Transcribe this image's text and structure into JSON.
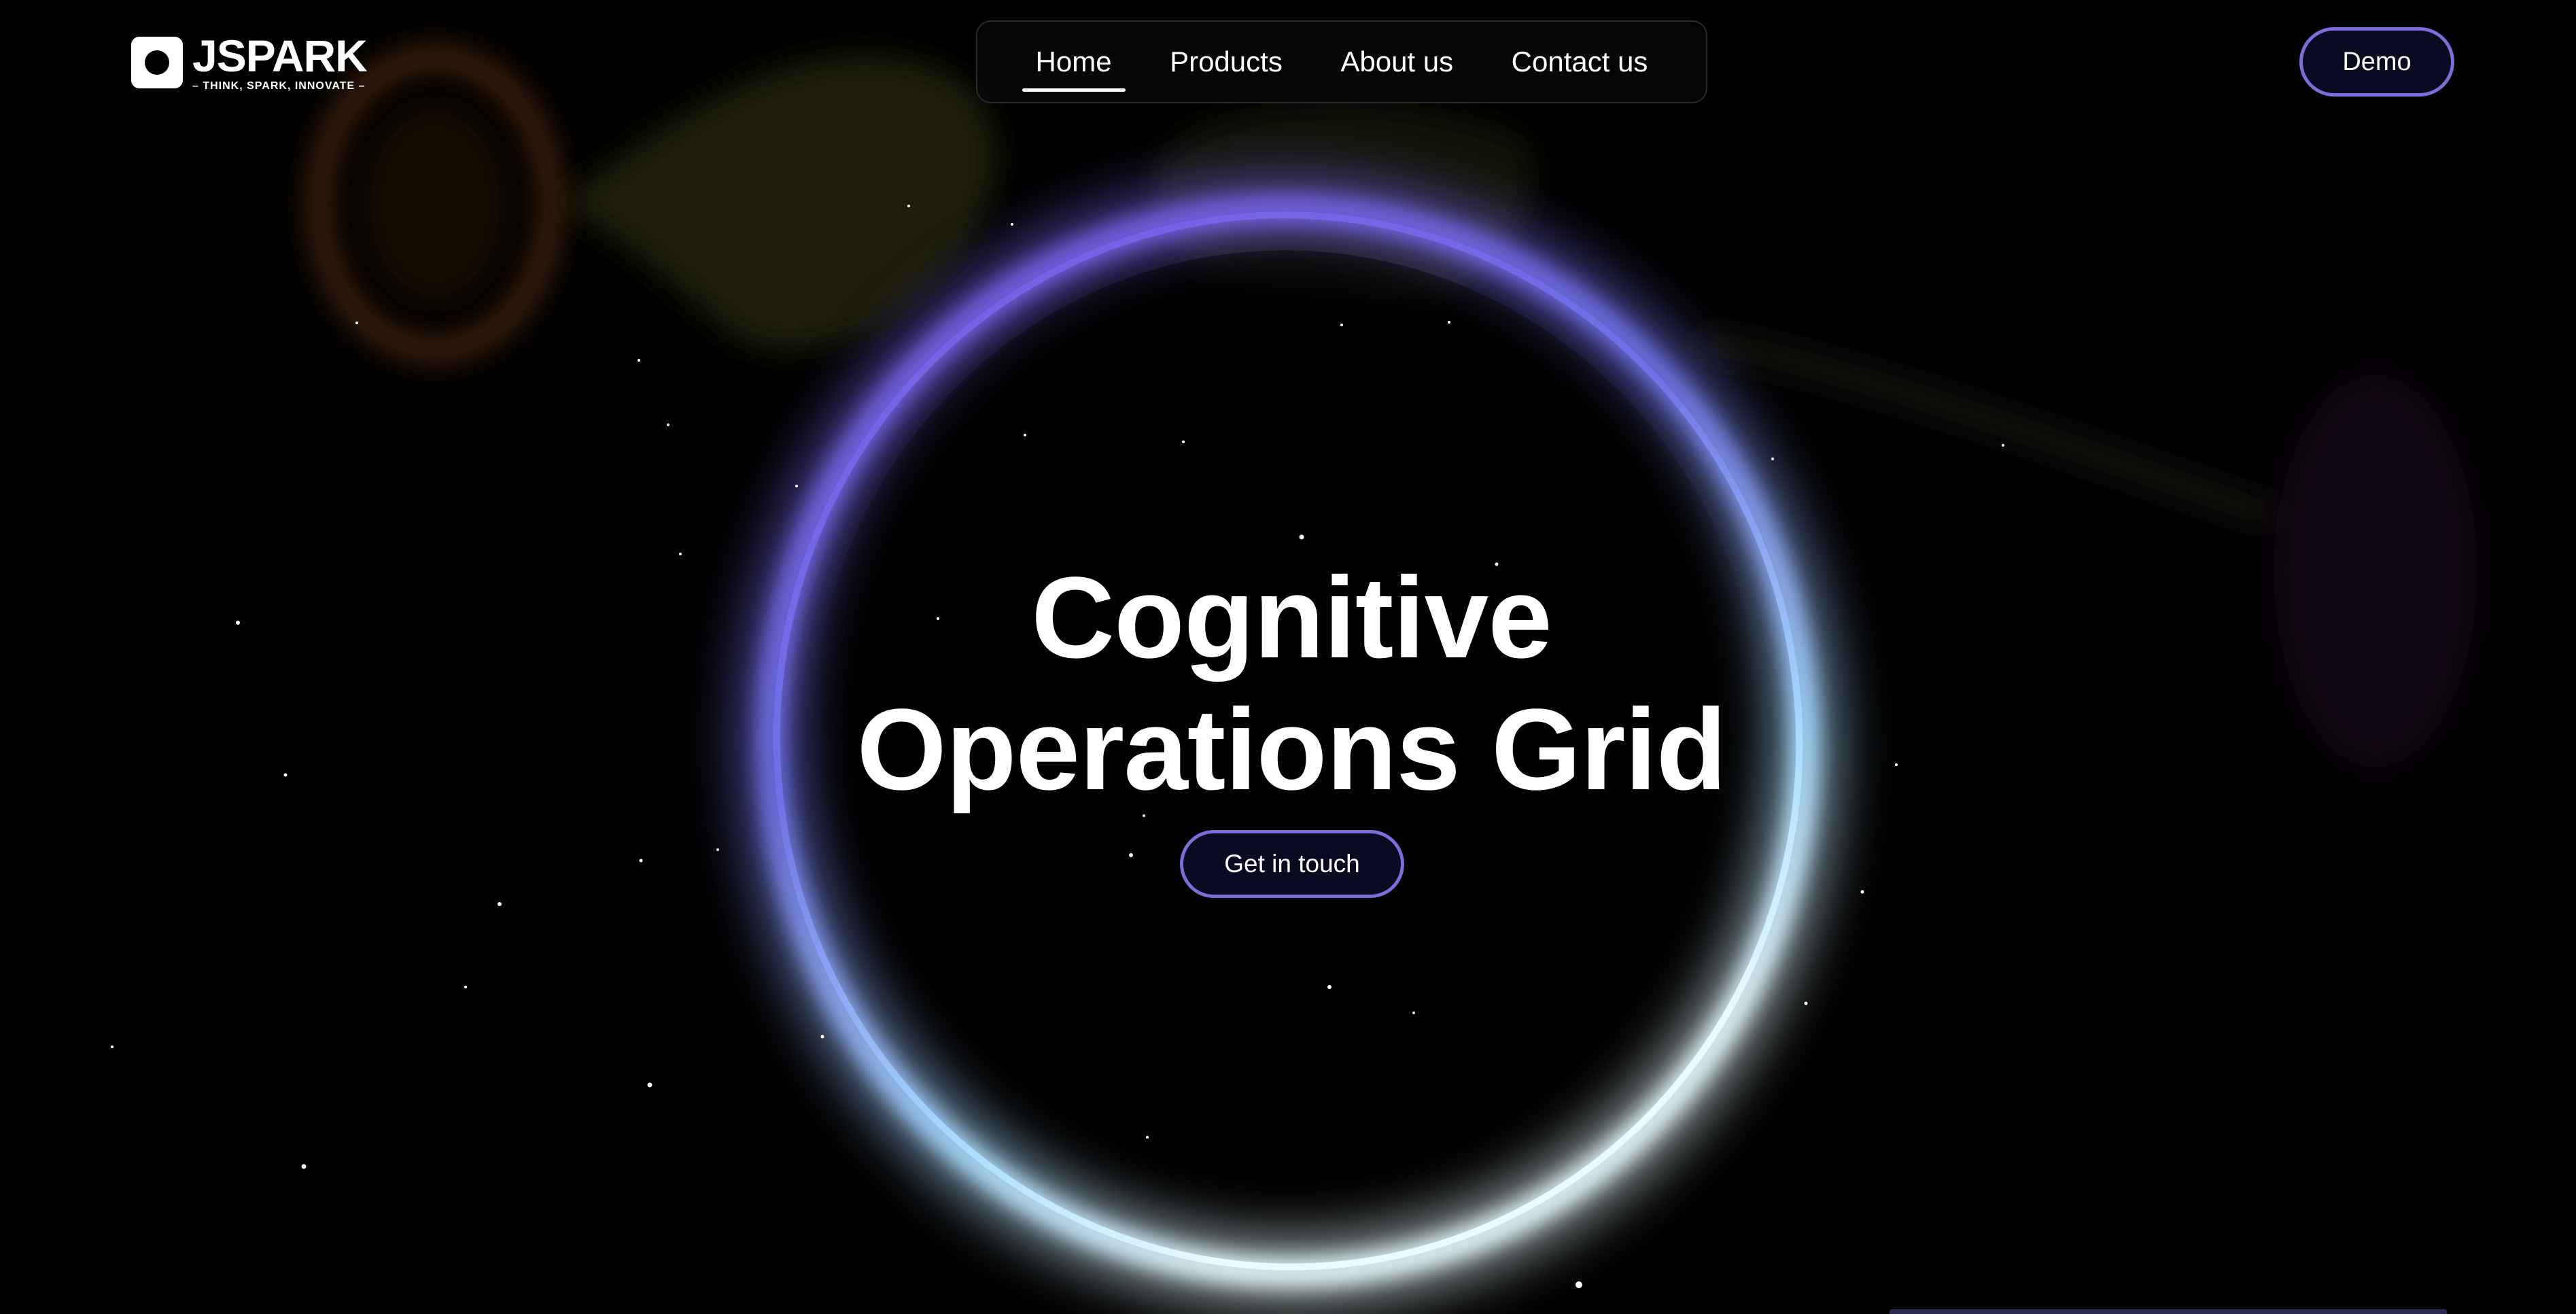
{
  "header": {
    "logo": {
      "name": "JSPARK",
      "tagline": "– THINK, SPARK, INNOVATE –",
      "icon": "logo-mark-icon"
    },
    "nav": [
      {
        "label": "Home",
        "active": true
      },
      {
        "label": "Products",
        "active": false
      },
      {
        "label": "About us",
        "active": false
      },
      {
        "label": "Contact us",
        "active": false
      }
    ],
    "demo_label": "Demo"
  },
  "hero": {
    "title_line1": "Cognitive",
    "title_line2": "Operations Grid",
    "cta_label": "Get in touch"
  },
  "colors": {
    "background": "#000000",
    "accent": "#7a6fd8",
    "ring_top": "#7b5ce6",
    "ring_bottom": "#c8f2ff",
    "button_fill": "#0a0a22"
  }
}
